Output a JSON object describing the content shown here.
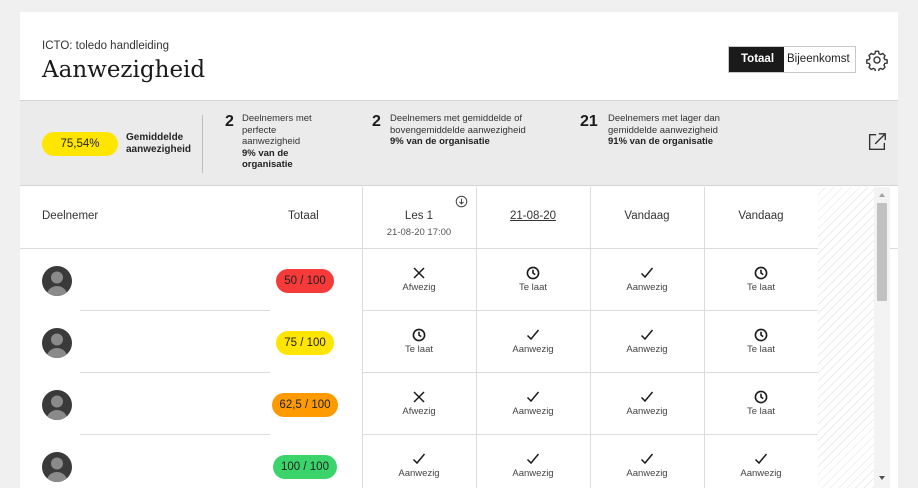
{
  "header": {
    "course": "ICTO: toledo handleiding",
    "title": "Aanwezigheid",
    "view_active": "Totaal",
    "view_other": "Bijeenkomst"
  },
  "stats": {
    "average_value": "75,54%",
    "average_label": "Gemiddelde aanwezigheid",
    "perfect": {
      "count": "2",
      "text": "Deelnemers met perfecte aanwezigheid",
      "pct": "9% van de organisatie"
    },
    "above": {
      "count": "2",
      "text": "Deelnemers met gemiddelde of bovengemiddelde aanwezigheid",
      "pct": "9% van de organisatie"
    },
    "below": {
      "count": "21",
      "text": "Deelnemers met lager dan gemiddelde aanwezigheid",
      "pct": "91% van de organisatie"
    }
  },
  "table": {
    "headers": {
      "participant": "Deelnemer",
      "total": "Totaal",
      "sessions": [
        {
          "title": "Les 1",
          "sub": "21-08-20 17:00"
        },
        {
          "title": "21-08-20",
          "sub": ""
        },
        {
          "title": "Vandaag",
          "sub": ""
        },
        {
          "title": "Vandaag",
          "sub": ""
        }
      ]
    },
    "rows": [
      {
        "score": "50 / 100",
        "statuses": [
          "Afwezig",
          "Te laat",
          "Aanwezig",
          "Te laat"
        ]
      },
      {
        "score": "75 / 100",
        "statuses": [
          "Te laat",
          "Aanwezig",
          "Aanwezig",
          "Te laat"
        ]
      },
      {
        "score": "62,5 / 100",
        "statuses": [
          "Afwezig",
          "Aanwezig",
          "Aanwezig",
          "Te laat"
        ]
      },
      {
        "score": "100 / 100",
        "statuses": [
          "Aanwezig",
          "Aanwezig",
          "Aanwezig",
          "Aanwezig"
        ]
      }
    ]
  },
  "icons": {
    "gear": "gear-icon",
    "external": "external-link-icon",
    "download": "download-icon",
    "absent": "cross-icon",
    "late": "clock-icon",
    "present": "check-icon"
  },
  "colors": {
    "avg_pill": "#ffe500",
    "score_red": "#f63a3a",
    "score_yellow": "#ffe500",
    "score_orange": "#ff9a00",
    "score_green": "#3bd46b"
  }
}
